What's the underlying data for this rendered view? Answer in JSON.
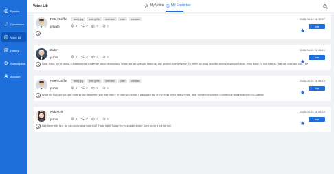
{
  "sidebar": {
    "items": [
      {
        "label": "Speaks",
        "icon": "speaks-icon",
        "active": false
      },
      {
        "label": "Conversion",
        "icon": "conversion-icon",
        "active": false
      },
      {
        "label": "Voice Lib",
        "icon": "voice-lib-icon",
        "active": true
      },
      {
        "label": "History",
        "icon": "history-icon",
        "active": false
      },
      {
        "label": "Subscription",
        "icon": "subscription-icon",
        "active": false
      },
      {
        "label": "Account",
        "icon": "account-icon",
        "active": false
      }
    ]
  },
  "header": {
    "title": "Voice Lib",
    "tabs": [
      {
        "label": "My Voice",
        "icon": "user-icon",
        "active": false
      },
      {
        "label": "My Favorites",
        "icon": "favorites-icon",
        "active": true
      }
    ]
  },
  "cards": [
    {
      "name": "Peter Griffin",
      "tags": [
        "family guy",
        "peter griffin",
        "animation",
        "male",
        "character"
      ],
      "privacy": "private",
      "stats": [
        "1",
        "0",
        "0",
        "1"
      ],
      "date": "2025-04-24 11:17:57",
      "use_label": "Use",
      "sample_text": ""
    },
    {
      "name": "Biden",
      "tags": [],
      "privacy": "public",
      "stats": [
        "0",
        "0",
        "0",
        "1"
      ],
      "date": "2025-04-24 11:06:16",
      "use_label": "Use",
      "sample_text": "Look, folks, we're facing a fundamental challenge to our democracy. When are we going to stand up and protect voting rights? It's been too long, and the American people know - they know in their hearts - that we must act now. The"
    },
    {
      "name": "Peter Griffin",
      "tags": [
        "family guy",
        "peter griffin",
        "animation",
        "male",
        "character"
      ],
      "privacy": "public",
      "stats": [
        "1",
        "0",
        "0",
        "1"
      ],
      "date": "2025-04-24 11:06:15",
      "use_label": "Use",
      "sample_text": "What the fuck did you just fucking say about me, you little bitch? I'll have you know I graduated top of my class in the Navy Seals, and I've been involved in numerous secret raids on Al-Quaeda"
    },
    {
      "name": "Neko Girl",
      "tags": [],
      "privacy": "public",
      "stats": [
        "0",
        "0",
        "0",
        "1"
      ],
      "date": "2025-04-24 11:06:14",
      "use_label": "Use",
      "sample_text": "Hey there little bro, do you know what time it is? Thats right! Today I'm your older sister! Dont worry it will be fun!"
    }
  ],
  "colors": {
    "accent": "#1e6fd9",
    "sidebar_bg": "#1e6fd9",
    "sidebar_active": "#0d55b8",
    "page_bg": "#f0f2f5"
  }
}
